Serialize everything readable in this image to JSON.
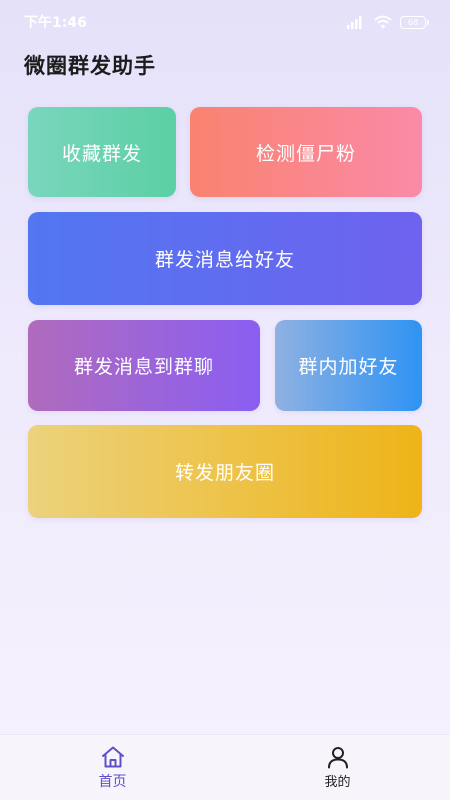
{
  "status_bar": {
    "time": "下午1:46",
    "battery": "68"
  },
  "page": {
    "title": "微圈群发助手"
  },
  "cards": {
    "favorite": "收藏群发",
    "detect": "检测僵尸粉",
    "friends": "群发消息给好友",
    "groupchat": "群发消息到群聊",
    "addfriend": "群内加好友",
    "moments": "转发朋友圈"
  },
  "tabs": [
    {
      "label": "首页",
      "icon": "home-icon",
      "active": true
    },
    {
      "label": "我的",
      "icon": "user-icon",
      "active": false
    }
  ],
  "colors": {
    "accent": "#5e51c8"
  }
}
